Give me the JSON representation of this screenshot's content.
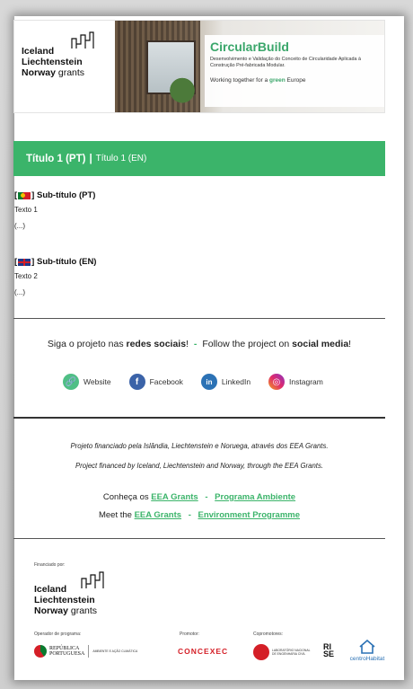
{
  "banner": {
    "eea_line1": "Iceland",
    "eea_line2": "Liechtenstein",
    "eea_line3_bold": "Norway",
    "eea_line3_light": "grants",
    "title": "CircularBuild",
    "subtitle": "Desenvolvimento e Validação do Conceito de Circularidade Aplicada à Construção Pré-fabricada Modular.",
    "tagline_pre": "Working together for a",
    "tagline_green": "green",
    "tagline_post": "Europe"
  },
  "title_bar": {
    "pt": "Título 1 (PT)",
    "separator": "|",
    "en": "Título 1 (EN)"
  },
  "section_pt": {
    "bracket_open": "[",
    "bracket_close": "]",
    "heading": "Sub-título (PT)",
    "text": "Texto 1",
    "ellipsis": "(...)"
  },
  "section_en": {
    "bracket_open": "[",
    "bracket_close": "]",
    "heading": "Sub-título (EN)",
    "text": "Texto 2",
    "ellipsis": "(...)"
  },
  "social": {
    "pt_pre": "Siga o projeto nas",
    "pt_bold": "redes sociais",
    "pt_post": "!",
    "dash": "-",
    "en_pre": "Follow the project on",
    "en_bold": "social media",
    "en_post": "!",
    "links": [
      {
        "label": "Website",
        "icon": "link-icon",
        "glyph": "🔗"
      },
      {
        "label": "Facebook",
        "icon": "facebook-icon",
        "glyph": "f"
      },
      {
        "label": "LinkedIn",
        "icon": "linkedin-icon",
        "glyph": "in"
      },
      {
        "label": "Instagram",
        "icon": "instagram-icon",
        "glyph": "◎"
      }
    ]
  },
  "financing": {
    "pt": "Projeto financiado pela Islândia, Liechtenstein e Noruega, através dos EEA Grants.",
    "en": "Project financed by Iceland, Liechtenstein and Norway, through the EEA Grants."
  },
  "know_more": {
    "pt_pre": "Conheça os",
    "pt_link1": "EEA Grants",
    "pt_link2": "Programa Ambiente",
    "en_pre": "Meet the",
    "en_link1": "EEA Grants",
    "en_link2": "Environment Programme",
    "dash": "-"
  },
  "footer": {
    "financed_by": "Financiado por:",
    "operator_label": "Operador de programa:",
    "promoter_label": "Promotor:",
    "copromoters_label": "Copromotores:",
    "republica_line1": "REPÚBLICA",
    "republica_line2": "PORTUGUESA",
    "ambiente": "AMBIENTE E AÇÃO CLIMÁTICA",
    "concexec": "CONCEXEC",
    "lnec_line1": "LABORATÓRIO NACIONAL",
    "lnec_line2": "DE ENGENHARIA CIVIL",
    "rise": "RI SE",
    "centro": "centroHabitat"
  },
  "colors": {
    "accent_green": "#3bb46a",
    "text_dark": "#222222"
  }
}
